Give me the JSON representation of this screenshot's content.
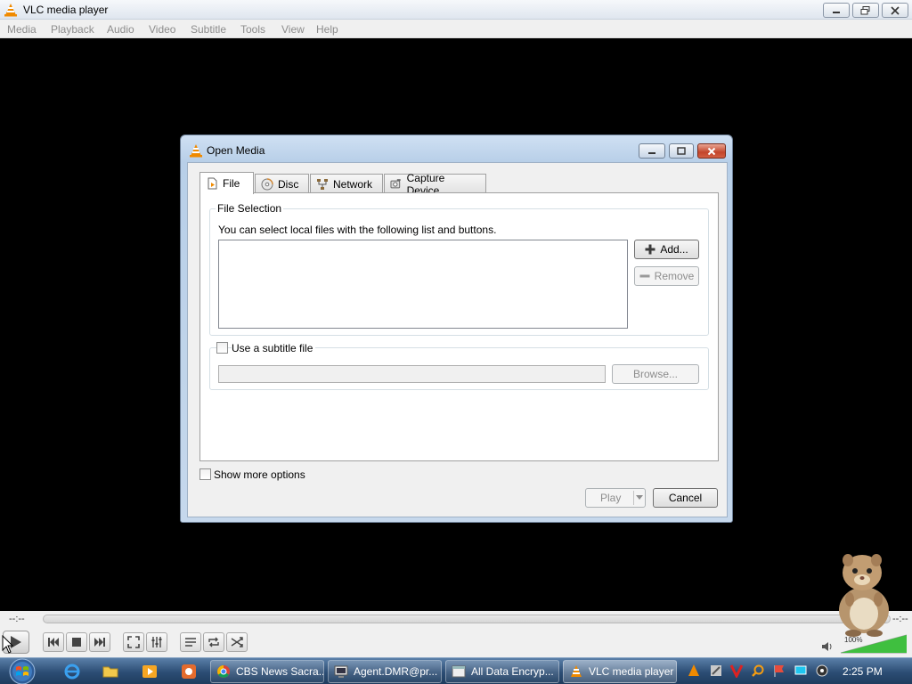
{
  "window": {
    "title": "VLC media player",
    "menu": [
      "Media",
      "Playback",
      "Audio",
      "Video",
      "Subtitle",
      "Tools",
      "View",
      "Help"
    ]
  },
  "controls": {
    "time_elapsed": "--:--",
    "time_total": "--:--",
    "volume_label": "100%",
    "volume_level": 1.0
  },
  "dialog": {
    "title": "Open Media",
    "tabs": [
      {
        "label": "File",
        "icon": "file-icon",
        "active": true
      },
      {
        "label": "Disc",
        "icon": "disc-icon",
        "active": false
      },
      {
        "label": "Network",
        "icon": "network-icon",
        "active": false
      },
      {
        "label": "Capture Device",
        "icon": "capture-device-icon",
        "active": false
      }
    ],
    "file_selection": {
      "group_title": "File Selection",
      "description": "You can select local files with the following list and buttons.",
      "files": [],
      "add_label": "Add...",
      "remove_label": "Remove"
    },
    "subtitle": {
      "checkbox_label": "Use a subtitle file",
      "checked": false,
      "path_value": "",
      "browse_label": "Browse..."
    },
    "show_more_options": {
      "label": "Show more options",
      "checked": false
    },
    "play_label": "Play",
    "cancel_label": "Cancel"
  },
  "taskbar": {
    "tasks": [
      {
        "label": "CBS News Sacra...",
        "icon": "chrome-icon",
        "active": false
      },
      {
        "label": "Agent.DMR@pr...",
        "icon": "remote-desktop-icon",
        "active": false
      },
      {
        "label": "All Data Encryp...",
        "icon": "window-icon",
        "active": false
      },
      {
        "label": "VLC media player",
        "icon": "vlc-cone-icon",
        "active": true
      }
    ],
    "clock": "2:25 PM"
  },
  "colors": {
    "vlc_orange": "#f08a00",
    "taskbar": "#2c4d74",
    "dialog_frame": "#b8cfe8",
    "close_red": "#c3452b"
  }
}
